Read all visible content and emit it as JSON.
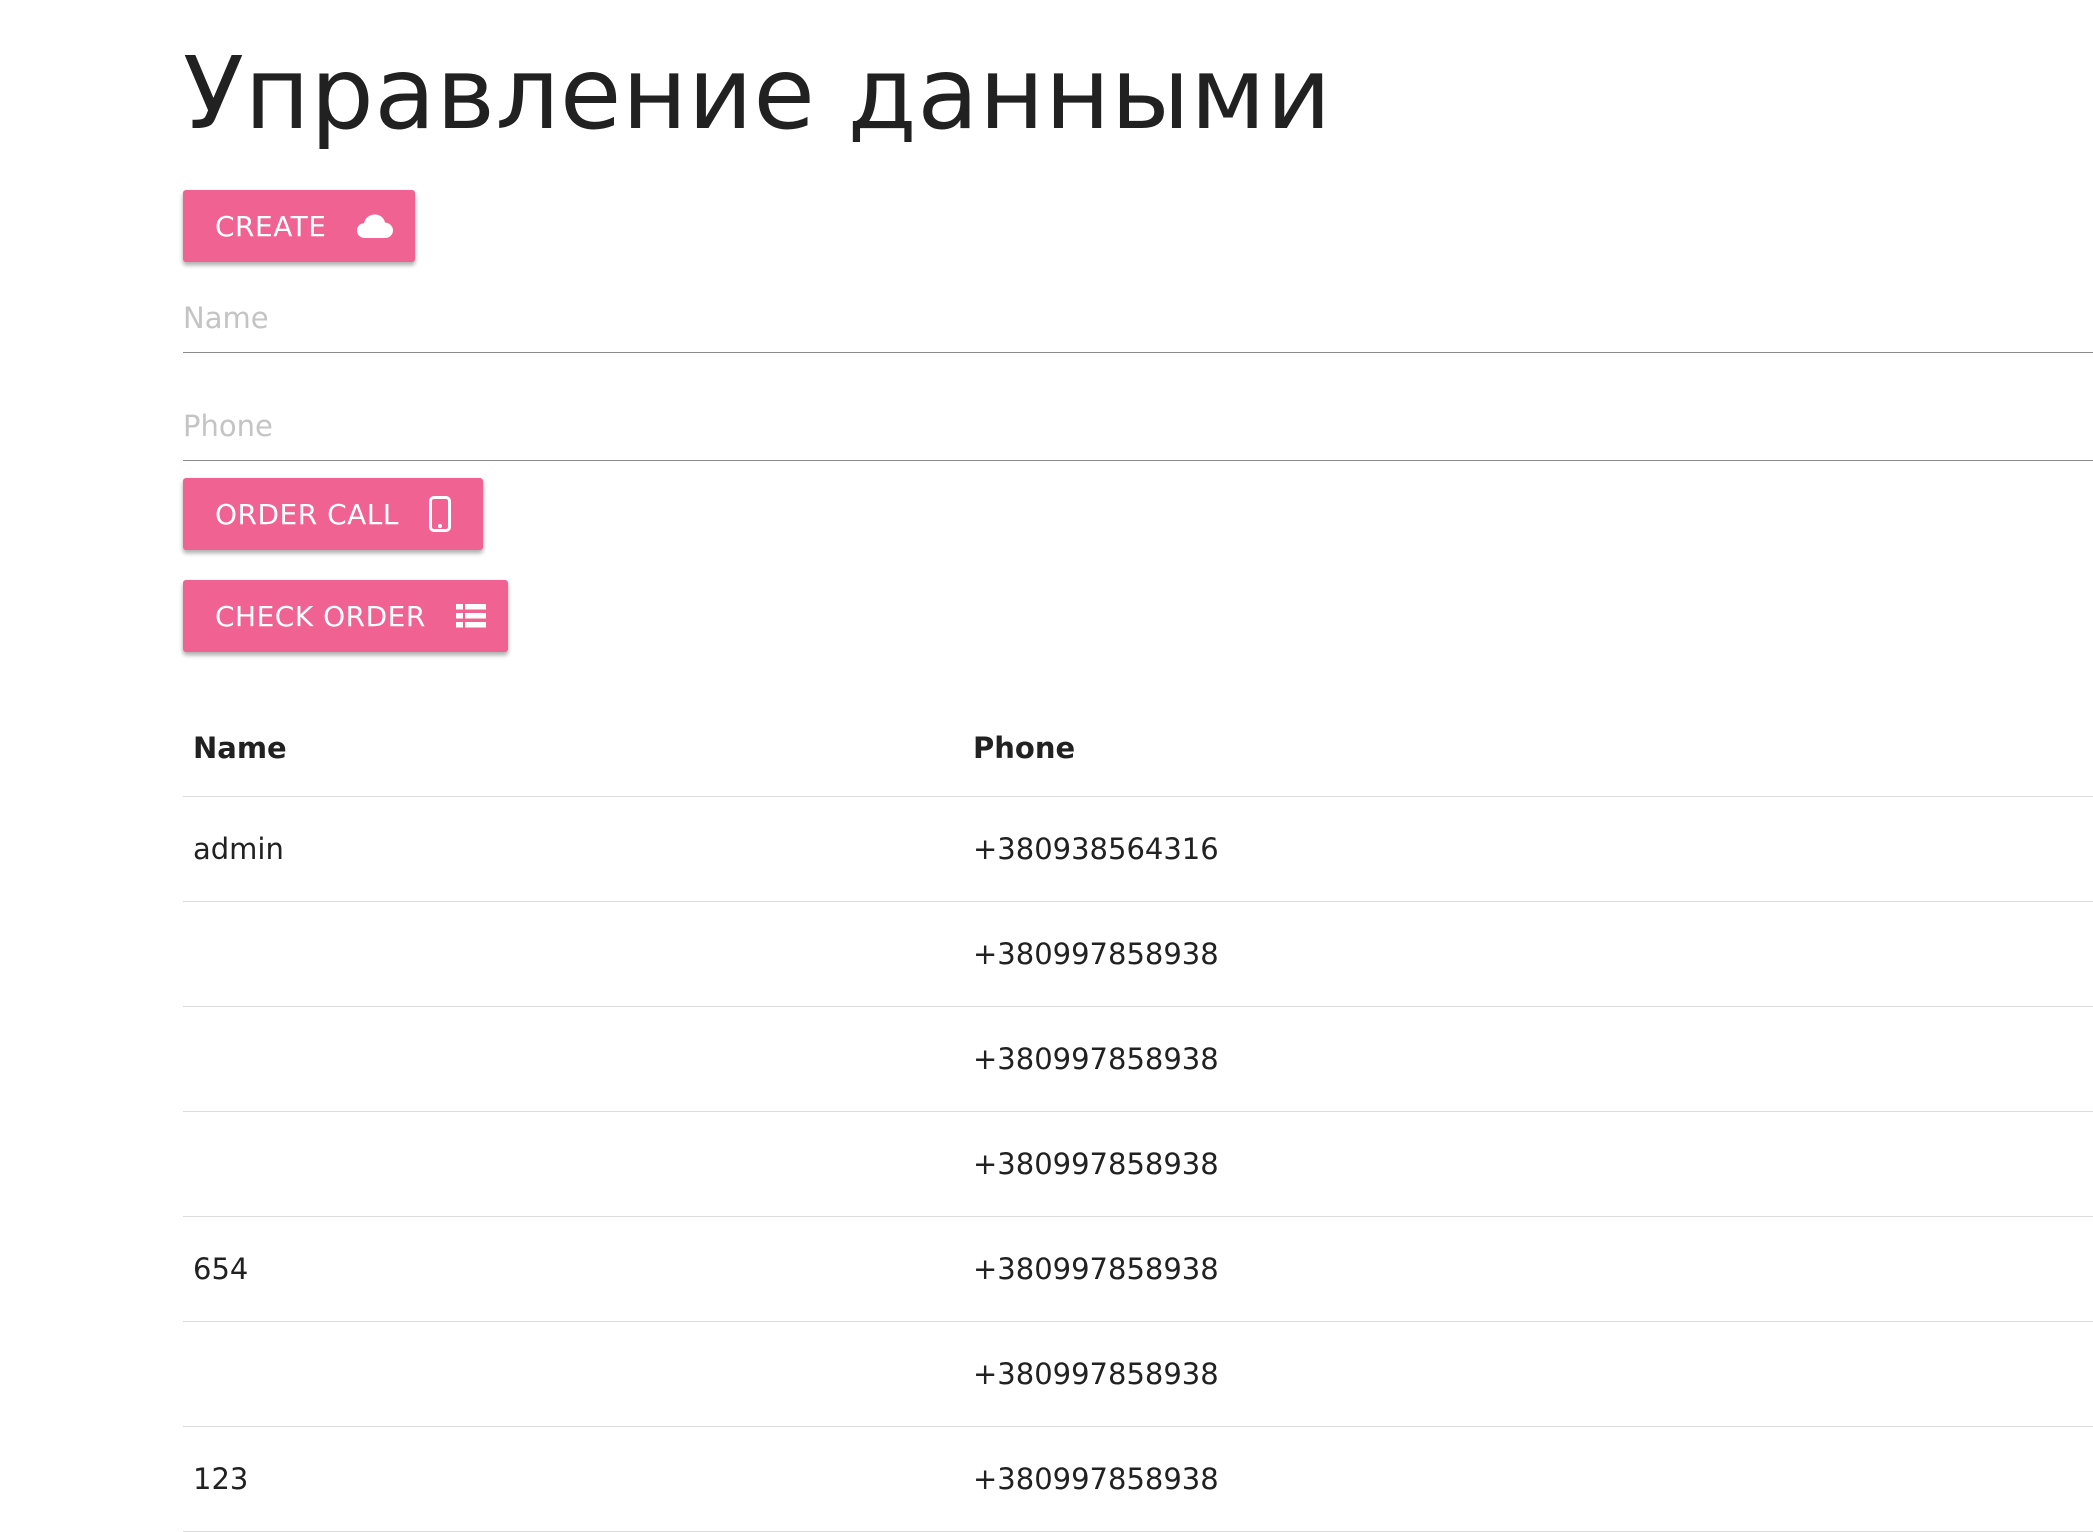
{
  "page": {
    "title": "Управление данными"
  },
  "actions": {
    "create_label": "CREATE",
    "create_icon": "cloud-icon",
    "order_call_label": "ORDER CALL",
    "order_call_icon": "mobile-phone-icon",
    "check_order_label": "CHECK ORDER",
    "check_order_icon": "list-icon"
  },
  "form": {
    "name_placeholder": "Name",
    "name_value": "",
    "phone_placeholder": "Phone",
    "phone_value": ""
  },
  "table": {
    "columns": [
      "Name",
      "Phone"
    ],
    "rows": [
      {
        "name": "admin",
        "phone": "+380938564316"
      },
      {
        "name": "",
        "phone": "+380997858938"
      },
      {
        "name": "",
        "phone": "+380997858938"
      },
      {
        "name": "",
        "phone": "+380997858938"
      },
      {
        "name": "654",
        "phone": "+380997858938"
      },
      {
        "name": "",
        "phone": "+380997858938"
      },
      {
        "name": "123",
        "phone": "+380997858938"
      }
    ]
  },
  "colors": {
    "accent": "#f06292",
    "text": "#212121",
    "placeholder": "#c4c4c4",
    "divider": "#dcdcdc"
  }
}
